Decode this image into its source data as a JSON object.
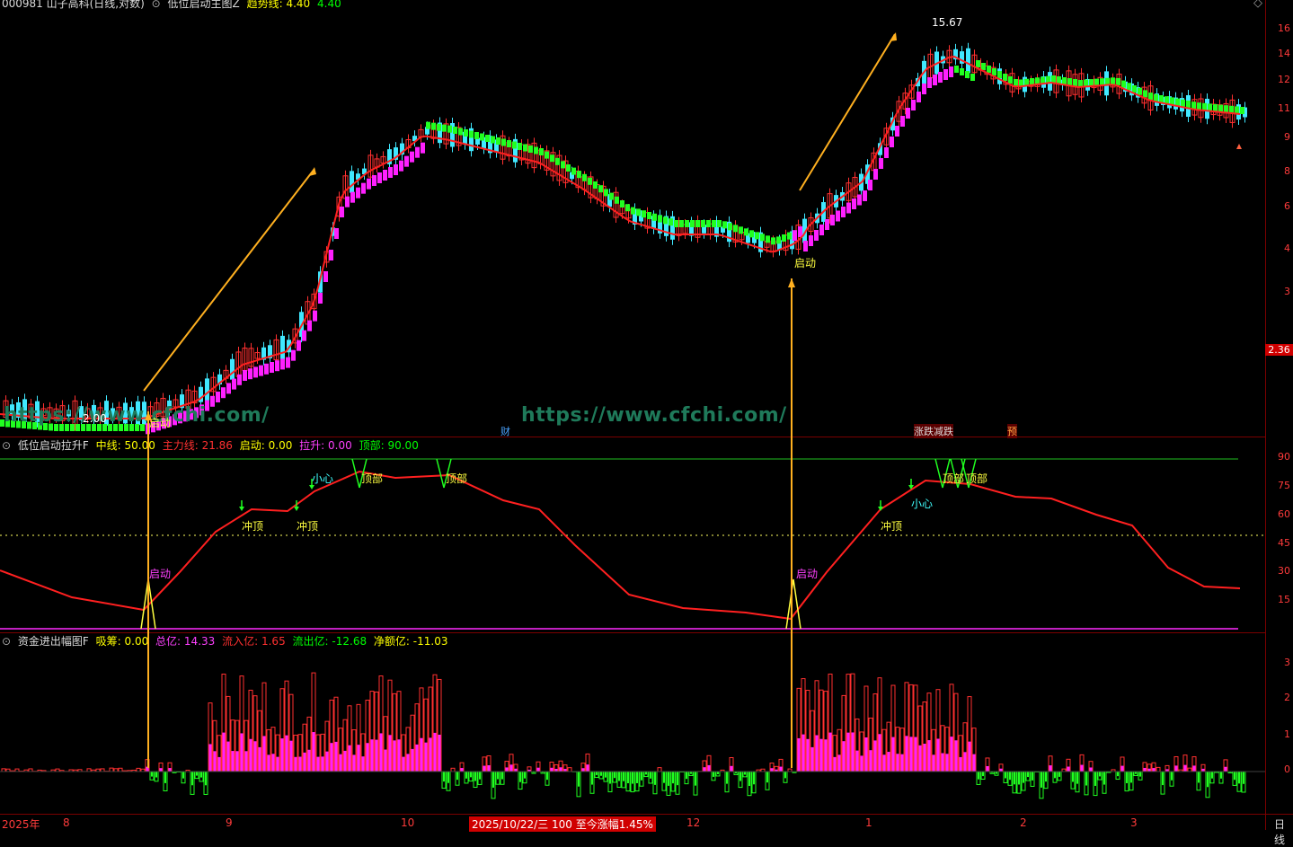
{
  "main": {
    "header_parts": [
      {
        "text": "000981 山子高科(日线,对数)",
        "color": "#dcdcdc"
      },
      {
        "text": "低位启动主图Z",
        "color": "#dcdcdc"
      },
      {
        "text": "趋势线:",
        "color": "#ffff00"
      },
      {
        "text": "4.40",
        "color": "#ffff00"
      },
      {
        "text": "4.40",
        "color": "#00ff00"
      }
    ],
    "y_ticks": [
      "16",
      "14",
      "12",
      "11",
      "9",
      "8",
      "6",
      "4",
      "3"
    ],
    "price_badge": "2.36",
    "high_label": "15.67",
    "low_label": "2.00",
    "launch_label_1": "启动",
    "launch_label_2": "启动",
    "tags": [
      {
        "text": "财",
        "color": "#4aa3ff"
      },
      {
        "text": "涨跌减跌",
        "color": "#dcdcdc"
      },
      {
        "text": "预",
        "color": "#ffa040"
      }
    ],
    "watermark": "https://www.cfchi.com/",
    "watermark_left": "https://www.cfchi.com/"
  },
  "mid": {
    "header_parts": [
      {
        "text": "低位启动拉升F",
        "color": "#dcdcdc"
      },
      {
        "text": "中线:",
        "color": "#ffff00"
      },
      {
        "text": "50.00",
        "color": "#ffff00"
      },
      {
        "text": "主力线:",
        "color": "#ff3030"
      },
      {
        "text": "21.86",
        "color": "#ff3030"
      },
      {
        "text": "启动:",
        "color": "#ffff00"
      },
      {
        "text": "0.00",
        "color": "#ffff00"
      },
      {
        "text": "拉升:",
        "color": "#ff40ff"
      },
      {
        "text": "0.00",
        "color": "#ff40ff"
      },
      {
        "text": "顶部:",
        "color": "#00ff00"
      },
      {
        "text": "90.00",
        "color": "#00ff00"
      }
    ],
    "y_ticks": [
      "90",
      "75",
      "60",
      "45",
      "30",
      "15"
    ],
    "signals": [
      {
        "text": "冲顶",
        "color": "#ffff40"
      },
      {
        "text": "冲顶",
        "color": "#ffff40"
      },
      {
        "text": "小心",
        "color": "#40ffff"
      },
      {
        "text": "顶部",
        "color": "#ffff40"
      },
      {
        "text": "顶部",
        "color": "#ffff40"
      },
      {
        "text": "启动",
        "color": "#ff40ff"
      },
      {
        "text": "启动",
        "color": "#ff40ff"
      },
      {
        "text": "冲顶",
        "color": "#ffff40"
      },
      {
        "text": "小心",
        "color": "#40ffff"
      },
      {
        "text": "顶部",
        "color": "#ffff40"
      },
      {
        "text": "顶部",
        "color": "#ffff40"
      }
    ]
  },
  "low": {
    "header_parts": [
      {
        "text": "资金进出幅图F",
        "color": "#dcdcdc"
      },
      {
        "text": "吸筹:",
        "color": "#ffff00"
      },
      {
        "text": "0.00",
        "color": "#ffff00"
      },
      {
        "text": "总亿:",
        "color": "#ff40ff"
      },
      {
        "text": "14.33",
        "color": "#ff40ff"
      },
      {
        "text": "流入亿:",
        "color": "#ff3030"
      },
      {
        "text": "1.65",
        "color": "#ff3030"
      },
      {
        "text": "流出亿:",
        "color": "#00ff00"
      },
      {
        "text": "-12.68",
        "color": "#00ff00"
      },
      {
        "text": "净额亿:",
        "color": "#ffff00"
      },
      {
        "text": "-11.03",
        "color": "#ffff00"
      }
    ],
    "y_ticks": [
      "3",
      "2",
      "1",
      "0"
    ]
  },
  "bottom": {
    "labels": [
      "2025年",
      "8",
      "9",
      "10",
      "12",
      "1",
      "2",
      "3"
    ],
    "status": "2025/10/22/三 100 至今涨幅1.45%",
    "corner": "日线"
  },
  "colors": {
    "up": "#ff3030",
    "down": "#40e8ff",
    "mid_line": "#ff2020",
    "trend_green": "#20ff20",
    "pink": "#ff20ff",
    "axis": "#7a0000"
  }
}
